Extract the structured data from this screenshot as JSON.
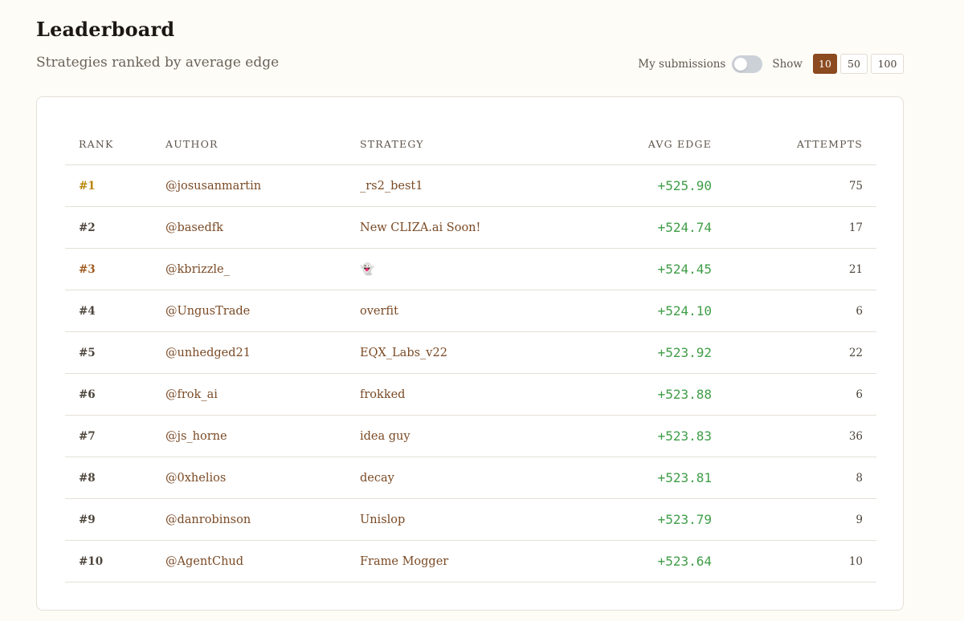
{
  "header": {
    "title": "Leaderboard",
    "subtitle": "Strategies ranked by average edge"
  },
  "controls": {
    "my_submissions_label": "My submissions",
    "my_submissions_on": false,
    "show_label": "Show",
    "page_sizes": [
      "10",
      "50",
      "100"
    ],
    "selected_page_size": "10"
  },
  "colors": {
    "accent": "#8b4a1f",
    "rank_gold": "#b8860b",
    "rank_bronze": "#a15c22",
    "edge_green": "#3f9d47",
    "link_brown": "#7a4a25"
  },
  "table": {
    "columns": [
      "RANK",
      "AUTHOR",
      "STRATEGY",
      "AVG EDGE",
      "ATTEMPTS"
    ],
    "rows": [
      {
        "rank": "#1",
        "author": "@josusanmartin",
        "strategy": "_rs2_best1",
        "avg_edge": "+525.90",
        "attempts": "75"
      },
      {
        "rank": "#2",
        "author": "@basedfk",
        "strategy": "New CLIZA.ai Soon!",
        "avg_edge": "+524.74",
        "attempts": "17"
      },
      {
        "rank": "#3",
        "author": "@kbrizzle_",
        "strategy": "👻",
        "avg_edge": "+524.45",
        "attempts": "21"
      },
      {
        "rank": "#4",
        "author": "@UngusTrade",
        "strategy": "overfit",
        "avg_edge": "+524.10",
        "attempts": "6"
      },
      {
        "rank": "#5",
        "author": "@unhedged21",
        "strategy": "EQX_Labs_v22",
        "avg_edge": "+523.92",
        "attempts": "22"
      },
      {
        "rank": "#6",
        "author": "@frok_ai",
        "strategy": "frokked",
        "avg_edge": "+523.88",
        "attempts": "6"
      },
      {
        "rank": "#7",
        "author": "@js_horne",
        "strategy": "idea guy",
        "avg_edge": "+523.83",
        "attempts": "36"
      },
      {
        "rank": "#8",
        "author": "@0xhelios",
        "strategy": "decay",
        "avg_edge": "+523.81",
        "attempts": "8"
      },
      {
        "rank": "#9",
        "author": "@danrobinson",
        "strategy": "Unislop",
        "avg_edge": "+523.79",
        "attempts": "9"
      },
      {
        "rank": "#10",
        "author": "@AgentChud",
        "strategy": "Frame Mogger",
        "avg_edge": "+523.64",
        "attempts": "10"
      }
    ]
  }
}
